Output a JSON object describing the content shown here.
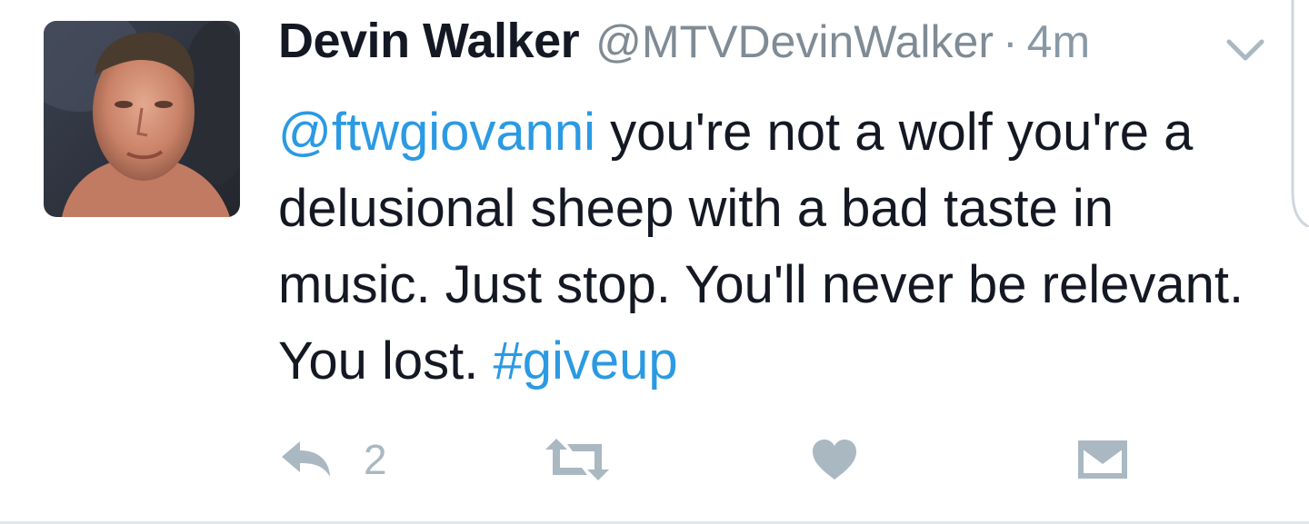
{
  "tweet": {
    "author_name": "Devin Walker",
    "handle": "@MTVDevinWalker",
    "separator": "·",
    "time": "4m",
    "text_parts": [
      {
        "type": "mention",
        "text": "@ftwgiovanni"
      },
      {
        "type": "text",
        "text": " you're not a wolf you're a delusional sheep with a bad taste in music. Just stop. You'll never be relevant. You lost. "
      },
      {
        "type": "hashtag",
        "text": "#giveup"
      }
    ],
    "reply_count": "2"
  },
  "icons": {
    "more": "chevron-down-icon",
    "reply": "reply-icon",
    "retweet": "retweet-icon",
    "like": "heart-icon",
    "dm": "envelope-icon"
  },
  "colors": {
    "name": "#141823",
    "meta": "#8899a6",
    "link": "#2b9ae3",
    "action_icon": "#aab8c2"
  }
}
